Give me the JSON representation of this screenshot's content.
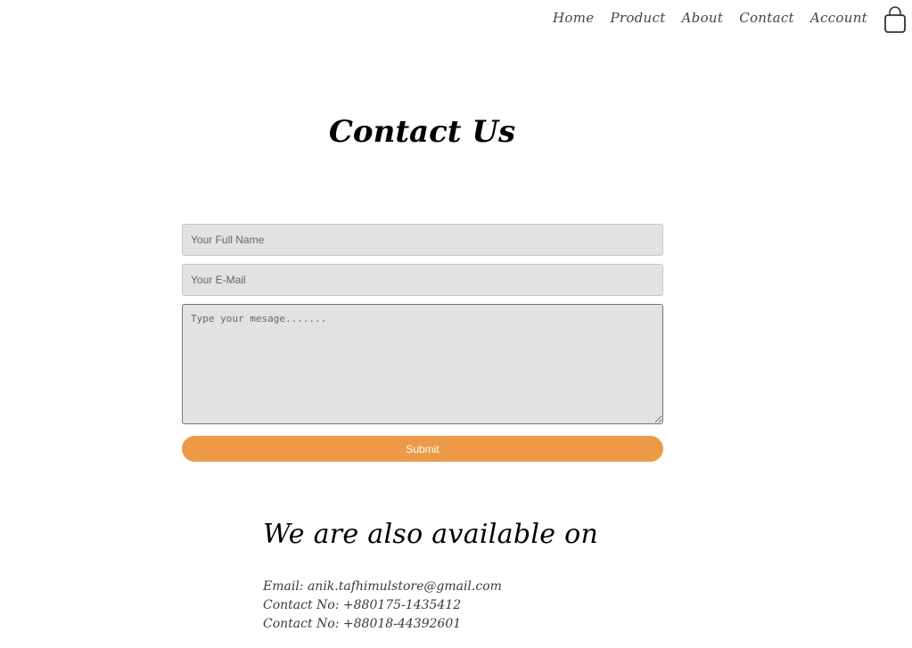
{
  "nav": {
    "items": [
      "Home",
      "Product",
      "About",
      "Contact",
      "Account"
    ]
  },
  "icons": {
    "cart": "shopping-bag-icon"
  },
  "page": {
    "title": "Contact Us"
  },
  "form": {
    "name_placeholder": "Your Full Name",
    "email_placeholder": "Your E-Mail",
    "message_placeholder": "Type your mesage.......",
    "name_value": "",
    "email_value": "",
    "message_value": "",
    "submit_label": "Submit"
  },
  "availability": {
    "title": "We are also available on",
    "lines": [
      "Email: anik.tafhimulstore@gmail.com",
      "Contact No: +880175-1435412",
      "Contact No: +88018-44392601"
    ]
  },
  "colors": {
    "accent": "#ec9a48",
    "field_bg": "#e2e2e2"
  }
}
